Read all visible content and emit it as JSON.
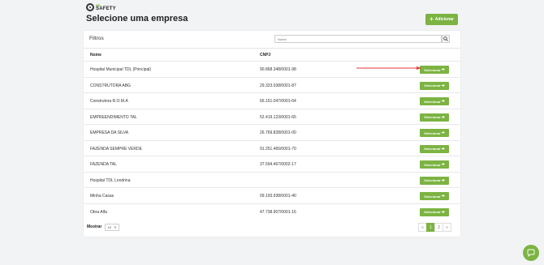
{
  "brand": {
    "line1": "BE",
    "line2": "SAFETY"
  },
  "header": {
    "title": "Selecione uma empresa",
    "add_label": "Adicionar"
  },
  "filters": {
    "title": "Filtros",
    "search_placeholder": "Nome"
  },
  "table": {
    "columns": [
      "Nome",
      "CNPJ"
    ],
    "select_label": "Selecionar",
    "rows": [
      {
        "name": "Hospital Municipal TDL (Principal)",
        "cnpj": "90.868.348/0001-98"
      },
      {
        "name": "CONSTRUTORA ABG",
        "cnpj": "29.323.038/0001-87"
      },
      {
        "name": "Construtora R.O.M.A",
        "cnpj": "66.151.047/0001-64"
      },
      {
        "name": "EMPREENDIMENTO TAL",
        "cnpj": "52.419.123/0001-65"
      },
      {
        "name": "EMPRESA DA SILVA",
        "cnpj": "26.769.828/0001-00"
      },
      {
        "name": "FAZENDA SEMPRE VERDE",
        "cnpj": "91.251.465/0001-70"
      },
      {
        "name": "FAZENDA TAL",
        "cnpj": "37.594.467/0002-17"
      },
      {
        "name": "Hospital TDL Londrina",
        "cnpj": ""
      },
      {
        "name": "Minha Casas",
        "cnpj": "09.193.938/0001-40"
      },
      {
        "name": "Obra Alfa",
        "cnpj": "47.738.907/0001-16"
      }
    ]
  },
  "footer": {
    "show_label": "Mostrar",
    "per_page": "10",
    "pages": [
      "«",
      "1",
      "2",
      "»"
    ],
    "current_page": "1"
  },
  "colors": {
    "accent": "#7cb342",
    "annotation_arrow": "#e53935"
  },
  "icons": {
    "search": "search-icon",
    "chat": "chat-icon"
  }
}
